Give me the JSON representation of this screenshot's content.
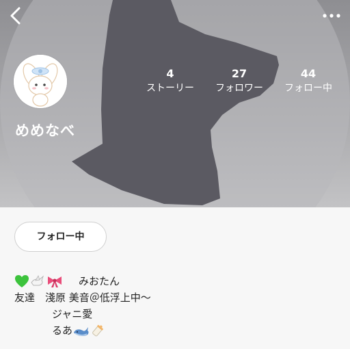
{
  "profile": {
    "username": "めめなべ",
    "follow_button_label": "フォロー中"
  },
  "stats": {
    "stories": {
      "count": "4",
      "label": "ストーリー"
    },
    "followers": {
      "count": "27",
      "label": "フォロワー"
    },
    "following": {
      "count": "44",
      "label": "フォロー中"
    }
  },
  "bio": {
    "line1_text": "みおたん",
    "line2_text": "友達　淺原 美音＠低浮上中～",
    "line3_text": "ジャニ愛",
    "line4_text": "るあ"
  },
  "icons": {
    "back": "chevron-left-icon",
    "more": "more-horizontal-icon",
    "avatar": "bunny-character-avatar",
    "bio_emojis_line1": [
      "green-heart-icon",
      "dove-icon",
      "ribbon-icon"
    ],
    "bio_emojis_line4": [
      "whale-icon",
      "baby-bottle-icon"
    ]
  },
  "colors": {
    "header_gradient_top": "#8e8e92",
    "header_gradient_bottom": "#c3c3c5",
    "silhouette": "#5b5a62",
    "circle_light": "#b8b8bb",
    "background": "#f7f7f7"
  }
}
